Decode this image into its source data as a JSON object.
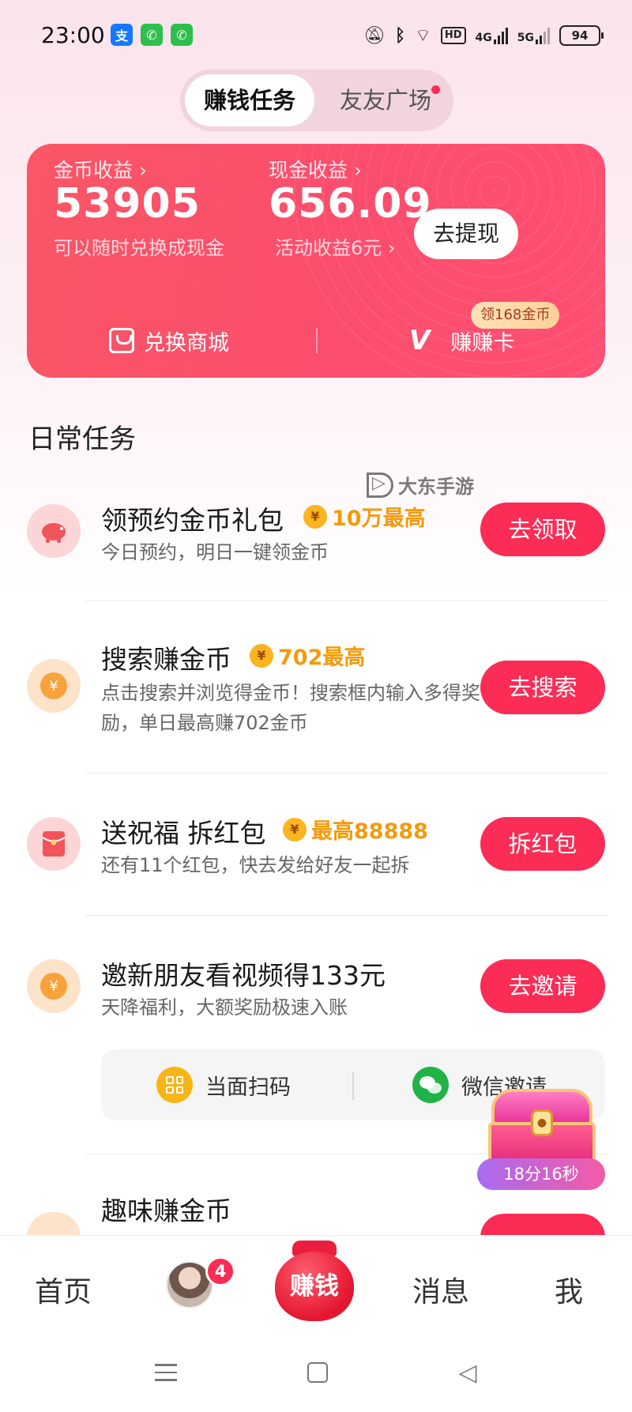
{
  "status_bar": {
    "time": "23:00",
    "apps": [
      "alipay-icon",
      "phone-icon",
      "phone-icon"
    ],
    "hd_tag": "HD",
    "net1": "4G",
    "net2": "5G",
    "battery": "94"
  },
  "segment": {
    "tabs": [
      {
        "label": "赚钱任务",
        "active": true
      },
      {
        "label": "友友广场",
        "active": false,
        "has_dot": true
      }
    ]
  },
  "earnings": {
    "coin_label": "金币收益 ›",
    "coin_value": "53905",
    "coin_sub": "可以随时兑换成现金",
    "cash_label": "现金收益 ›",
    "cash_value": "656.09",
    "cash_sub": "活动收益6元 ›",
    "withdraw_label": "去提现",
    "shop_label": "兑换商城",
    "zzk_label": "赚赚卡",
    "zzk_badge": "领168金币"
  },
  "daily": {
    "title": "日常任务",
    "watermark": "大东手游"
  },
  "tasks": [
    {
      "title": "领预约金币礼包",
      "reward": "10万最高",
      "desc": "今日预约，明日一键领金币",
      "button": "去领取",
      "icon": "piggy-bank-icon"
    },
    {
      "title": "搜索赚金币",
      "reward": "702最高",
      "desc": "点击搜索并浏览得金币！搜索框内输入多得奖励，单日最高赚702金币",
      "button": "去搜索",
      "icon": "yen-coin-icon"
    },
    {
      "title": "送祝福 拆红包",
      "reward": "最高88888",
      "desc": "还有11个红包，快去发给好友一起拆",
      "button": "拆红包",
      "icon": "red-envelope-icon"
    },
    {
      "title": "邀新朋友看视频得133元",
      "desc": "天降福利，大额奖励极速入账",
      "button": "去邀请",
      "icon": "yen-coin-icon"
    },
    {
      "title": "趣味赚金币",
      "icon": "fun-coin-icon"
    }
  ],
  "invite": {
    "scan_label": "当面扫码",
    "wechat_label": "微信邀请"
  },
  "chest": {
    "timer": "18分16秒"
  },
  "bottom_nav": {
    "home": "首页",
    "avatar_badge": "4",
    "earn": "赚钱",
    "messages": "消息",
    "me": "我"
  },
  "colors": {
    "accent": "#fb2c55",
    "card": "#fa5666",
    "reward": "#f39a0d"
  }
}
